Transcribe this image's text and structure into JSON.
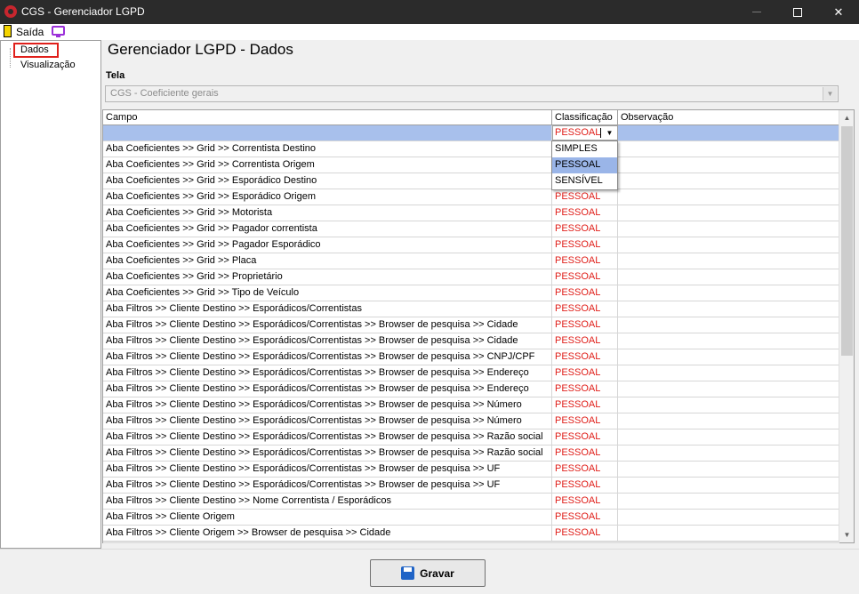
{
  "window": {
    "title": "CGS - Gerenciador LGPD",
    "controls": {
      "minimize": "–",
      "maximize": "☐",
      "close": "✕"
    }
  },
  "menu": {
    "exit_label": "Saída"
  },
  "tree": {
    "items": [
      {
        "label": "Dados",
        "selected": true
      },
      {
        "label": "Visualização"
      }
    ]
  },
  "header": {
    "title": "Gerenciador LGPD - Dados"
  },
  "tela": {
    "label": "Tela",
    "value": "CGS - Coeficiente gerais"
  },
  "grid": {
    "columns": [
      "Campo",
      "Classificação",
      "Observação"
    ],
    "editor_value": "PESSOAL",
    "dropdown_options": [
      "SIMPLES",
      "PESSOAL",
      "SENSÍVEL"
    ],
    "dropdown_selected": "PESSOAL",
    "rows": [
      {
        "campo": "",
        "classificacao": "PESSOAL",
        "observacao": ""
      },
      {
        "campo": "Aba Coeficientes >> Grid >> Correntista Destino",
        "classificacao": "",
        "observacao": ""
      },
      {
        "campo": "Aba Coeficientes >> Grid >> Correntista Origem",
        "classificacao": "",
        "observacao": ""
      },
      {
        "campo": "Aba Coeficientes >> Grid >> Esporádico Destino",
        "classificacao": "",
        "observacao": ""
      },
      {
        "campo": "Aba Coeficientes >> Grid >> Esporádico Origem",
        "classificacao": "PESSOAL",
        "observacao": ""
      },
      {
        "campo": "Aba Coeficientes >> Grid >> Motorista",
        "classificacao": "PESSOAL",
        "observacao": ""
      },
      {
        "campo": "Aba Coeficientes >> Grid >> Pagador correntista",
        "classificacao": "PESSOAL",
        "observacao": ""
      },
      {
        "campo": "Aba Coeficientes >> Grid >> Pagador Esporádico",
        "classificacao": "PESSOAL",
        "observacao": ""
      },
      {
        "campo": "Aba Coeficientes >> Grid >> Placa",
        "classificacao": "PESSOAL",
        "observacao": ""
      },
      {
        "campo": "Aba Coeficientes >> Grid >> Proprietário",
        "classificacao": "PESSOAL",
        "observacao": ""
      },
      {
        "campo": "Aba Coeficientes >> Grid >> Tipo de Veículo",
        "classificacao": "PESSOAL",
        "observacao": ""
      },
      {
        "campo": "Aba Filtros >> Cliente Destino >> Esporádicos/Correntistas",
        "classificacao": "PESSOAL",
        "observacao": ""
      },
      {
        "campo": "Aba Filtros >> Cliente Destino >> Esporádicos/Correntistas >> Browser de pesquisa >> Cidade",
        "classificacao": "PESSOAL",
        "observacao": ""
      },
      {
        "campo": "Aba Filtros >> Cliente Destino >> Esporádicos/Correntistas >> Browser de pesquisa >> Cidade",
        "classificacao": "PESSOAL",
        "observacao": ""
      },
      {
        "campo": "Aba Filtros >> Cliente Destino >> Esporádicos/Correntistas >> Browser de pesquisa >> CNPJ/CPF",
        "classificacao": "PESSOAL",
        "observacao": ""
      },
      {
        "campo": "Aba Filtros >> Cliente Destino >> Esporádicos/Correntistas >> Browser de pesquisa >> Endereço",
        "classificacao": "PESSOAL",
        "observacao": ""
      },
      {
        "campo": "Aba Filtros >> Cliente Destino >> Esporádicos/Correntistas >> Browser de pesquisa >> Endereço",
        "classificacao": "PESSOAL",
        "observacao": ""
      },
      {
        "campo": "Aba Filtros >> Cliente Destino >> Esporádicos/Correntistas >> Browser de pesquisa >> Número",
        "classificacao": "PESSOAL",
        "observacao": ""
      },
      {
        "campo": "Aba Filtros >> Cliente Destino >> Esporádicos/Correntistas >> Browser de pesquisa >> Número",
        "classificacao": "PESSOAL",
        "observacao": ""
      },
      {
        "campo": "Aba Filtros >> Cliente Destino >> Esporádicos/Correntistas >> Browser de pesquisa >> Razão social",
        "classificacao": "PESSOAL",
        "observacao": ""
      },
      {
        "campo": "Aba Filtros >> Cliente Destino >> Esporádicos/Correntistas >> Browser de pesquisa >> Razão social",
        "classificacao": "PESSOAL",
        "observacao": ""
      },
      {
        "campo": "Aba Filtros >> Cliente Destino >> Esporádicos/Correntistas >> Browser de pesquisa >> UF",
        "classificacao": "PESSOAL",
        "observacao": ""
      },
      {
        "campo": "Aba Filtros >> Cliente Destino >> Esporádicos/Correntistas >> Browser de pesquisa >> UF",
        "classificacao": "PESSOAL",
        "observacao": ""
      },
      {
        "campo": "Aba Filtros >> Cliente Destino >> Nome Correntista / Esporádicos",
        "classificacao": "PESSOAL",
        "observacao": ""
      },
      {
        "campo": "Aba Filtros >> Cliente Origem",
        "classificacao": "PESSOAL",
        "observacao": ""
      },
      {
        "campo": "Aba Filtros >> Cliente Origem >> Browser de pesquisa >> Cidade",
        "classificacao": "PESSOAL",
        "observacao": ""
      }
    ]
  },
  "footer": {
    "save_label": "Gravar"
  },
  "colors": {
    "accent_red": "#e0201b",
    "selection_blue": "#a8c0ec",
    "titlebar": "#2b2b2b"
  },
  "icons": [
    "app-logo-icon",
    "exit-icon",
    "screen-icon",
    "dropdown-arrow-icon",
    "save-disk-icon"
  ]
}
